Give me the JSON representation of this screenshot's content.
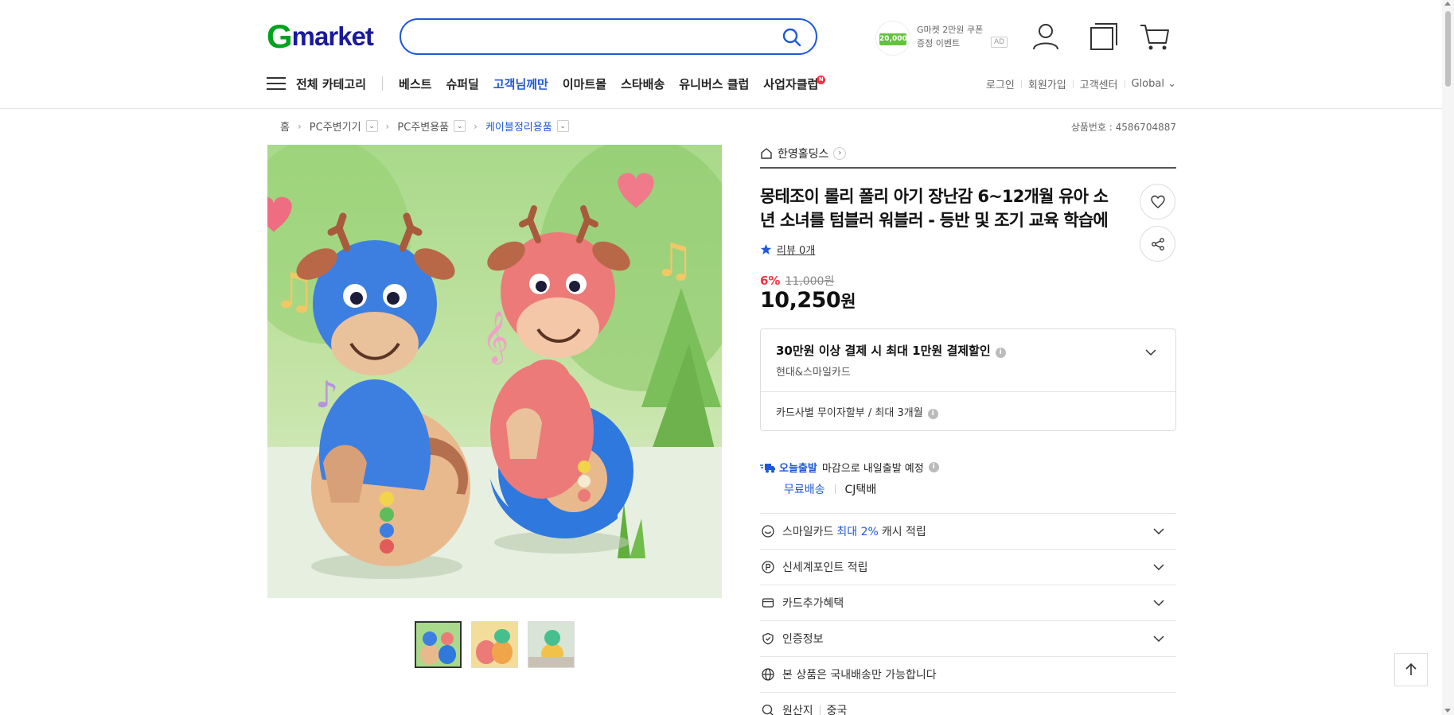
{
  "header": {
    "logo_g": "G",
    "logo_rest": "market",
    "search": {
      "value": "",
      "placeholder": ""
    },
    "ad": {
      "amount": "20,000",
      "line1": "G마켓 2만원 쿠폰",
      "line2": "증정 이벤트",
      "tag": "AD"
    },
    "icons": [
      "user-icon",
      "recent-items-icon",
      "cart-icon"
    ]
  },
  "nav": {
    "all_categories": "전체 카테고리",
    "items": [
      {
        "label": "베스트",
        "highlight": false
      },
      {
        "label": "슈퍼딜",
        "highlight": false
      },
      {
        "label": "고객님께만",
        "highlight": true
      },
      {
        "label": "이마트몰",
        "highlight": false
      },
      {
        "label": "스타배송",
        "highlight": false
      },
      {
        "label": "유니버스 클럽",
        "highlight": false
      },
      {
        "label": "사업자클럽",
        "highlight": false,
        "badge": "N"
      }
    ],
    "util": [
      "로그인",
      "회원가입",
      "고객센터",
      "Global ⌄"
    ]
  },
  "breadcrumb": {
    "items": [
      "홈",
      "PC주변기기",
      "PC주변용품",
      "케이블정리용품"
    ],
    "product_no": "상품번호 : 4586704887"
  },
  "product": {
    "seller": "한영홀딩스",
    "title": "몽테조이 롤리 폴리 아기 장난감 6~12개월 유아 소년 소녀를 텀블러 워블러 - 등반 및 조기 교육 학습에",
    "review": "리뷰 0개",
    "discount_pct": "6%",
    "original_price": "11,000원",
    "price": "10,250",
    "price_unit": "원"
  },
  "card_benefit": {
    "title": "30만원 이상 결제 시 최대 1만원 결제할인",
    "cards": "현대&스마일카드",
    "installment": "카드사별 무이자할부 / 최대 3개월"
  },
  "shipping": {
    "badge": "오늘출발",
    "text": "마감으로 내일출발 예정",
    "free": "무료배송",
    "courier": "CJ택배"
  },
  "rows": {
    "smile_pre": "스마일카드",
    "smile_blue": "최대 2%",
    "smile_post": "캐시 적립",
    "shinsegae": "신세계포인트 적립",
    "card_extra": "카드추가혜택",
    "cert": "인증정보",
    "domestic": "본 상품은 국내배송만 가능합니다",
    "origin_label": "원산지",
    "origin_value": "중국"
  },
  "colors": {
    "accent": "#1f58d8",
    "sale": "#f43142",
    "logo_green": "#00a31f",
    "logo_blue": "#1a1a9a"
  }
}
